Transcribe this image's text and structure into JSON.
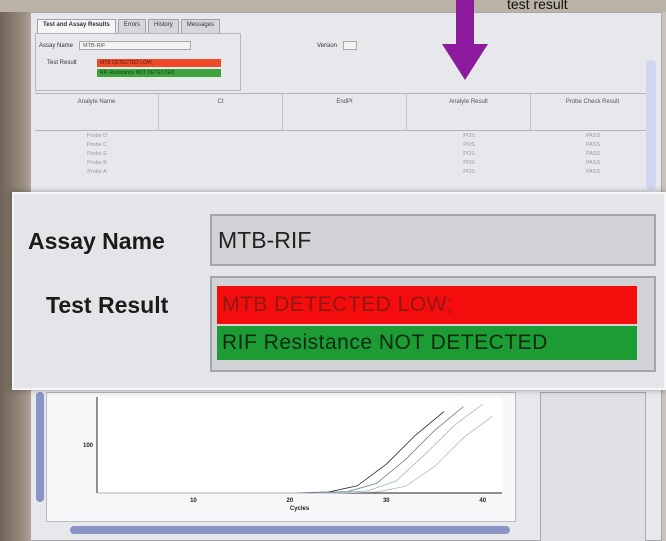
{
  "annotation": {
    "text": "test result"
  },
  "tabs": [
    {
      "label": "Test and Assay Results"
    },
    {
      "label": "Errors"
    },
    {
      "label": "History"
    },
    {
      "label": "Messages"
    }
  ],
  "mini": {
    "assay_label": "Assay Name",
    "assay_value": "MTB-RIF",
    "version_label": "Version",
    "test_result_label": "Test Result",
    "result_line1": "MTB DETECTED LOW;",
    "result_line2": "RIF Resistance NOT DETECTED"
  },
  "table": {
    "headers": [
      "Analyte Name",
      "Ct",
      "EndPt",
      "Analyte Result",
      "Probe Check Result"
    ],
    "rows": [
      [
        "Probe D",
        "",
        "",
        "POS",
        "PASS"
      ],
      [
        "Probe C",
        "",
        "",
        "POS",
        "PASS"
      ],
      [
        "Probe E",
        "",
        "",
        "POS",
        "PASS"
      ],
      [
        "Probe B",
        "",
        "",
        "POS",
        "PASS"
      ],
      [
        "Probe A",
        "",
        "",
        "POS",
        "PASS"
      ]
    ]
  },
  "chart_data": {
    "type": "line",
    "xlabel": "Cycles",
    "ylabel": "",
    "x_ticks": [
      10,
      20,
      30,
      40
    ],
    "y_ticks": [
      100
    ],
    "xlim": [
      0,
      42
    ],
    "series": [
      {
        "values_x": [
          0,
          20,
          24,
          27,
          30,
          33,
          36
        ],
        "values_y": [
          0,
          0,
          2,
          15,
          60,
          120,
          170
        ]
      },
      {
        "values_x": [
          0,
          22,
          26,
          29,
          32,
          35,
          38
        ],
        "values_y": [
          0,
          0,
          3,
          20,
          70,
          130,
          180
        ]
      },
      {
        "values_x": [
          0,
          24,
          28,
          31,
          34,
          37,
          40
        ],
        "values_y": [
          0,
          0,
          4,
          25,
          80,
          140,
          185
        ]
      },
      {
        "values_x": [
          0,
          25,
          29,
          32,
          35,
          38,
          41
        ],
        "values_y": [
          0,
          0,
          2,
          14,
          55,
          115,
          160
        ]
      }
    ]
  },
  "callout": {
    "assay_label": "Assay Name",
    "assay_value": "MTB-RIF",
    "test_result_label": "Test Result",
    "result_line1": "MTB DETECTED LOW;",
    "result_line2": "RIF Resistance NOT DETECTED"
  },
  "colors": {
    "arrow": "#8b1a9c",
    "result_red": "#f50d0d",
    "result_green": "#1d9c35"
  }
}
